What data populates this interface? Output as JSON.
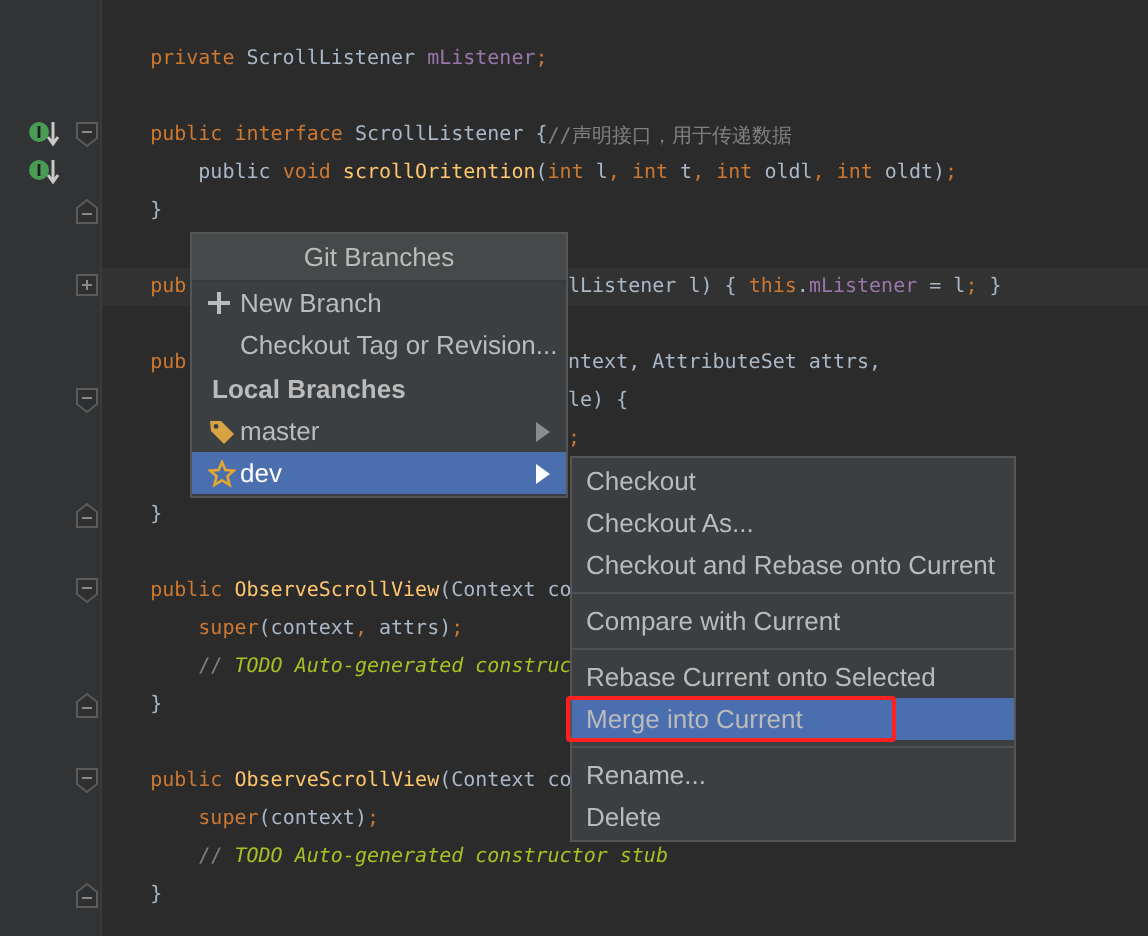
{
  "editor": {
    "lines": [
      {
        "tokens": [
          {
            "kind": "keyword",
            "text": "    private "
          },
          {
            "kind": "plain",
            "text": "ScrollListener "
          },
          {
            "kind": "field",
            "text": "mListener"
          },
          {
            "kind": "keyword",
            "text": ";"
          }
        ]
      },
      {
        "blank_before": true,
        "implemented": true,
        "fold_start": true,
        "tokens": [
          {
            "kind": "keyword",
            "text": "    public interface "
          },
          {
            "kind": "plain",
            "text": "ScrollListener {"
          },
          {
            "kind": "comment",
            "text": "//声明接口，用于传递数据"
          }
        ]
      },
      {
        "blank_before": false,
        "implemented": true,
        "tokens": [
          {
            "kind": "plain",
            "text": "        public "
          },
          {
            "kind": "keyword",
            "text": "void "
          },
          {
            "kind": "method",
            "text": "scrollOritention"
          },
          {
            "kind": "plain",
            "text": "("
          },
          {
            "kind": "keyword",
            "text": "int "
          },
          {
            "kind": "plain",
            "text": "l"
          },
          {
            "kind": "keyword",
            "text": ", int "
          },
          {
            "kind": "plain",
            "text": "t"
          },
          {
            "kind": "keyword",
            "text": ", int "
          },
          {
            "kind": "plain",
            "text": "oldl"
          },
          {
            "kind": "keyword",
            "text": ", int "
          },
          {
            "kind": "plain",
            "text": "oldt)"
          },
          {
            "kind": "keyword",
            "text": ";"
          }
        ]
      },
      {
        "blank_before": false,
        "fold_end": true,
        "tokens": [
          {
            "kind": "plain",
            "text": "    }"
          }
        ]
      },
      {
        "blank_before": true,
        "current": true,
        "folded": true,
        "tokens": [
          {
            "kind": "keyword",
            "text": "    pub"
          }
        ],
        "tokens_right": [
          {
            "kind": "plain",
            "text": "lListener l) { "
          },
          {
            "kind": "keyword",
            "text": "this"
          },
          {
            "kind": "plain",
            "text": "."
          },
          {
            "kind": "field",
            "text": "mListener"
          },
          {
            "kind": "plain",
            "text": " = l"
          },
          {
            "kind": "keyword",
            "text": ";"
          },
          {
            "kind": "plain",
            "text": " }"
          }
        ]
      },
      {
        "blank_before": true,
        "tokens": [
          {
            "kind": "keyword",
            "text": "    pub"
          }
        ],
        "tokens_right": [
          {
            "kind": "plain",
            "text": "ntext, AttributeSet attrs,"
          }
        ]
      },
      {
        "blank_before": false,
        "fold_start": true,
        "tokens_right": [
          {
            "kind": "plain",
            "text": "le) {"
          }
        ]
      },
      {
        "blank_before": false,
        "tokens_right": [
          {
            "kind": "keyword",
            "text": ";"
          }
        ]
      },
      {
        "blank_before": true,
        "fold_end": true,
        "tokens": [
          {
            "kind": "plain",
            "text": "    }"
          }
        ]
      },
      {
        "blank_before": true,
        "fold_start": true,
        "tokens": [
          {
            "kind": "keyword",
            "text": "    public "
          },
          {
            "kind": "method",
            "text": "ObserveScrollView"
          },
          {
            "kind": "plain",
            "text": "(Context co"
          }
        ]
      },
      {
        "blank_before": false,
        "tokens": [
          {
            "kind": "keyword",
            "text": "        super"
          },
          {
            "kind": "plain",
            "text": "(context"
          },
          {
            "kind": "keyword",
            "text": ", "
          },
          {
            "kind": "plain",
            "text": "attrs)"
          },
          {
            "kind": "keyword",
            "text": ";"
          }
        ]
      },
      {
        "blank_before": false,
        "tokens": [
          {
            "kind": "comment",
            "text": "        // "
          },
          {
            "kind": "todo",
            "text": "TODO Auto-generated construc"
          }
        ]
      },
      {
        "blank_before": false,
        "fold_end": true,
        "tokens": [
          {
            "kind": "plain",
            "text": "    }"
          }
        ]
      },
      {
        "blank_before": true,
        "fold_start": true,
        "tokens": [
          {
            "kind": "keyword",
            "text": "    public "
          },
          {
            "kind": "method",
            "text": "ObserveScrollView"
          },
          {
            "kind": "plain",
            "text": "(Context co"
          }
        ]
      },
      {
        "blank_before": false,
        "tokens": [
          {
            "kind": "keyword",
            "text": "        super"
          },
          {
            "kind": "plain",
            "text": "(context)"
          },
          {
            "kind": "keyword",
            "text": ";"
          }
        ]
      },
      {
        "blank_before": false,
        "tokens": [
          {
            "kind": "comment",
            "text": "        // "
          },
          {
            "kind": "todo",
            "text": "TODO Auto-generated constructor stub"
          }
        ]
      },
      {
        "blank_before": false,
        "fold_end": true,
        "tokens": [
          {
            "kind": "plain",
            "text": "    }"
          }
        ]
      }
    ]
  },
  "git_branches_popup": {
    "title": "Git Branches",
    "items": [
      {
        "kind": "create",
        "label": "New Branch",
        "selected": false
      },
      {
        "kind": "action",
        "label": "Checkout Tag or Revision...",
        "selected": false
      },
      {
        "kind": "header",
        "label": "Local Branches"
      },
      {
        "kind": "branch",
        "label": "master",
        "favorite": false,
        "selected": false
      },
      {
        "kind": "branch",
        "label": "dev",
        "favorite": true,
        "selected": true
      }
    ]
  },
  "branch_submenu": {
    "items": [
      {
        "label": "Checkout",
        "separator_before": false,
        "selected": false,
        "highlighted": false
      },
      {
        "label": "Checkout As...",
        "separator_before": false,
        "selected": false,
        "highlighted": false
      },
      {
        "label": "Checkout and Rebase onto Current",
        "separator_before": false,
        "selected": false,
        "highlighted": false
      },
      {
        "label": "Compare with Current",
        "separator_before": true,
        "selected": false,
        "highlighted": false
      },
      {
        "label": "Rebase Current onto Selected",
        "separator_before": true,
        "selected": false,
        "highlighted": false
      },
      {
        "label": "Merge into Current",
        "separator_before": false,
        "selected": true,
        "highlighted": true
      },
      {
        "label": "Rename...",
        "separator_before": true,
        "selected": false,
        "highlighted": false
      },
      {
        "label": "Delete",
        "separator_before": false,
        "selected": false,
        "highlighted": false
      }
    ]
  }
}
